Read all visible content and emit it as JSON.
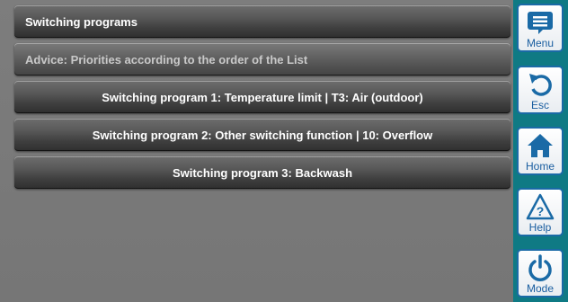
{
  "header": {
    "title": "Switching programs"
  },
  "advice": {
    "text": "Advice: Priorities according to the order of the List"
  },
  "programs": [
    {
      "label": "Switching program 1: Temperature limit | T3: Air (outdoor)"
    },
    {
      "label": "Switching program 2: Other switching function | 10: Overflow"
    },
    {
      "label": "Switching program 3: Backwash"
    }
  ],
  "sidebar": {
    "buttons": [
      {
        "label": "Menu",
        "icon": "menu-icon"
      },
      {
        "label": "Esc",
        "icon": "back-arrow-icon"
      },
      {
        "label": "Home",
        "icon": "home-icon"
      },
      {
        "label": "Help",
        "icon": "help-warning-icon"
      },
      {
        "label": "Mode",
        "icon": "power-icon"
      }
    ],
    "accent": "#1a6aa6",
    "background": "#0f7a84"
  }
}
